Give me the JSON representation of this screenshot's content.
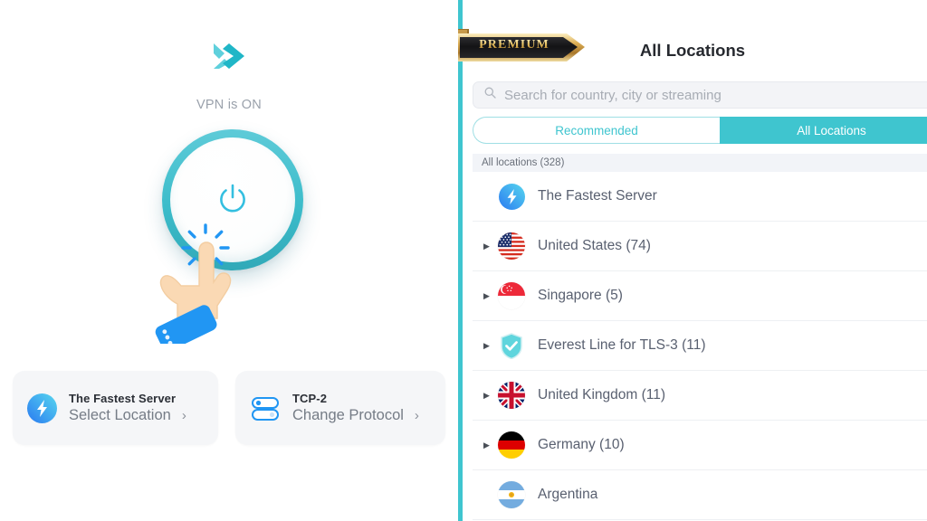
{
  "app": {
    "brand_logo_icon": "x-logo-icon",
    "accent_color": "#3fc5cf",
    "divider_color": "#3fc5cf"
  },
  "left_panel": {
    "status_text": "VPN is ON",
    "power_button": {
      "icon": "power-icon",
      "state": "on",
      "ring_color": "#3cbcca"
    },
    "cursor": {
      "icon": "hand-pointer-icon",
      "burst_icon": "click-burst-icon"
    },
    "cards": [
      {
        "name": "server-card",
        "icon": "lightning-bolt-icon",
        "title": "The Fastest Server",
        "subtitle": "Select Location",
        "chevron": "›"
      },
      {
        "name": "protocol-card",
        "icon": "toggle-sliders-icon",
        "title": "TCP-2",
        "subtitle": "Change Protocol",
        "chevron": "›"
      }
    ]
  },
  "right_panel": {
    "title": "All Locations",
    "premium_badge": {
      "label": "PREMIUM",
      "icon": "ribbon-icon",
      "gold_color": "#d8aa4e",
      "body_color": "#1d1d1f"
    },
    "search": {
      "icon": "search-icon",
      "placeholder": "Search for country, city or streaming",
      "value": ""
    },
    "tabs": [
      {
        "label": "Recommended",
        "active": false
      },
      {
        "label": "All Locations",
        "active": true
      }
    ],
    "section_header": "All locations (328)",
    "locations": [
      {
        "name": "The Fastest Server",
        "flag_icon": "fastest-server-bolt-icon",
        "expandable": false,
        "arrow_icon": "triangle-right-icon"
      },
      {
        "name": "United States (74)",
        "flag_icon": "flag-us-icon",
        "expandable": true,
        "arrow_icon": "triangle-right-icon"
      },
      {
        "name": "Singapore (5)",
        "flag_icon": "flag-sg-icon",
        "expandable": true,
        "arrow_icon": "triangle-right-icon"
      },
      {
        "name": "Everest Line for TLS-3 (11)",
        "flag_icon": "shield-check-icon",
        "expandable": true,
        "arrow_icon": "triangle-right-icon"
      },
      {
        "name": "United Kingdom (11)",
        "flag_icon": "flag-uk-icon",
        "expandable": true,
        "arrow_icon": "triangle-right-icon"
      },
      {
        "name": "Germany (10)",
        "flag_icon": "flag-de-icon",
        "expandable": true,
        "arrow_icon": "triangle-right-icon"
      },
      {
        "name": "Argentina",
        "flag_icon": "flag-ar-icon",
        "expandable": false,
        "arrow_icon": "triangle-right-icon"
      }
    ]
  }
}
